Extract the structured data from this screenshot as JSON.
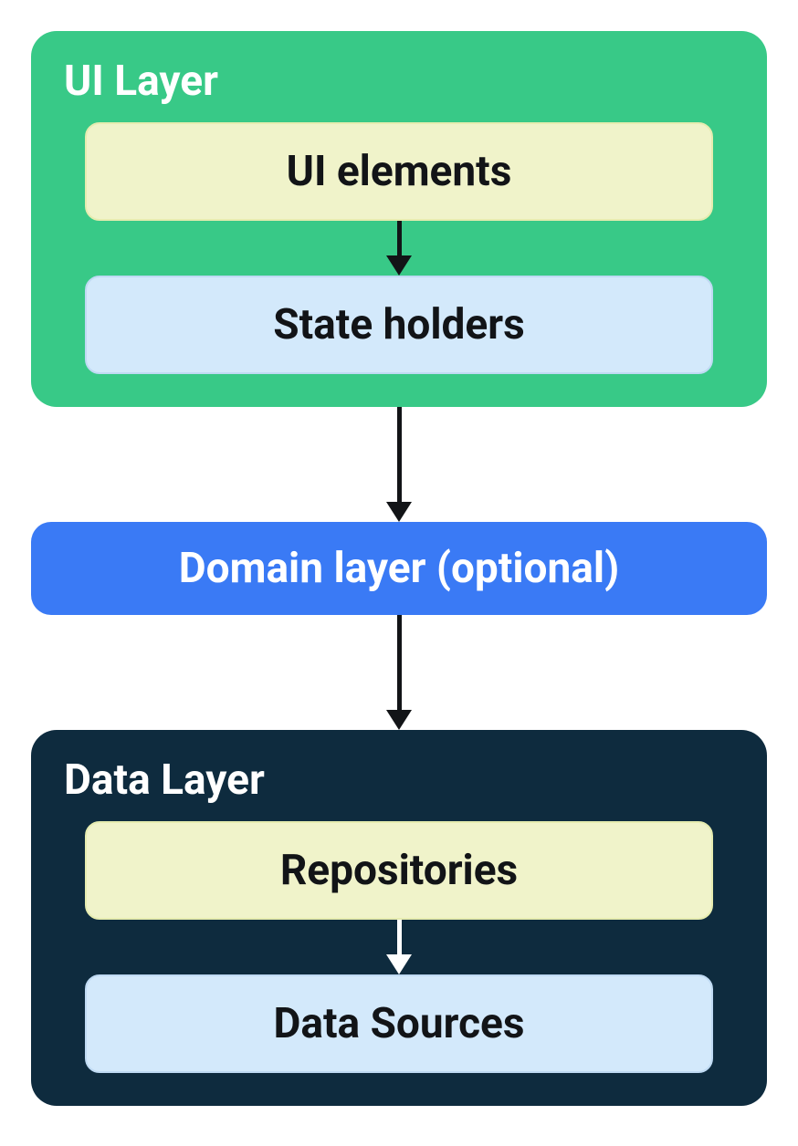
{
  "layers": {
    "ui": {
      "title": "UI Layer",
      "boxes": {
        "ui_elements": "UI elements",
        "state_holders": "State holders"
      }
    },
    "domain": {
      "label": "Domain layer (optional)"
    },
    "data": {
      "title": "Data Layer",
      "boxes": {
        "repositories": "Repositories",
        "data_sources": "Data Sources"
      }
    }
  },
  "colors": {
    "ui_layer_bg": "#38c987",
    "data_layer_bg": "#0e2b3e",
    "domain_bg": "#3a7af5",
    "pale_yellow": "#f0f3ca",
    "pale_blue": "#d3e9fb",
    "arrow_dark": "#121417",
    "arrow_light": "#ffffff"
  },
  "architecture_flow": [
    "UI elements",
    "State holders",
    "Domain layer (optional)",
    "Repositories",
    "Data Sources"
  ]
}
